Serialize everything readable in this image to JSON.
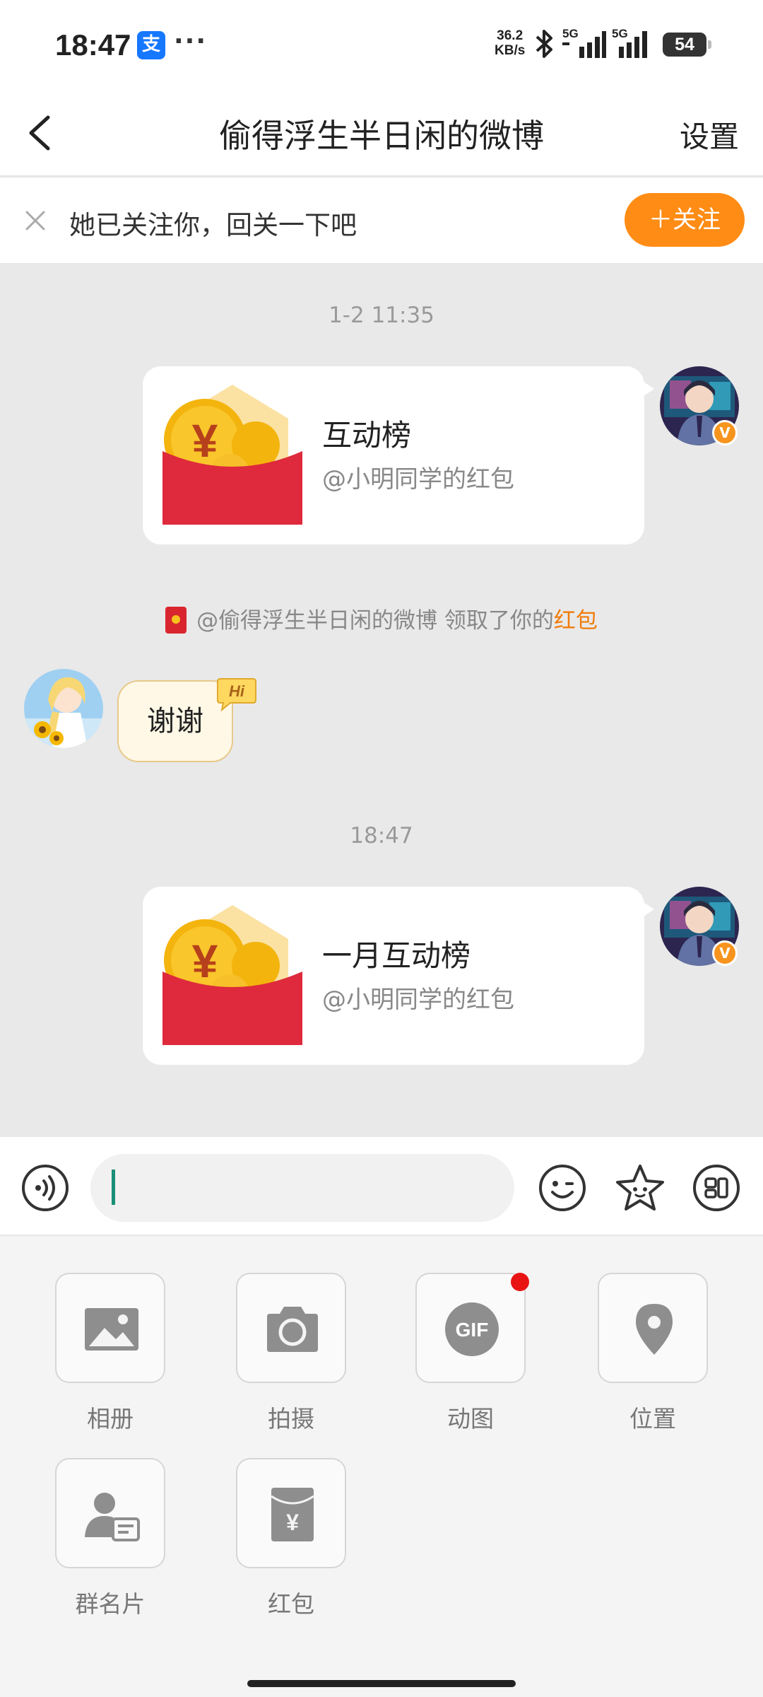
{
  "status_bar": {
    "time": "18:47",
    "alipay_icon_text": "支",
    "more": "···",
    "net_speed_value": "36.2",
    "net_speed_unit": "KB/s",
    "sim1": "5G",
    "sim2": "5G",
    "battery": "54"
  },
  "header": {
    "title": "偷得浮生半日闲的微博",
    "settings_label": "设置"
  },
  "follow_bar": {
    "text": "她已关注你，回关一下吧",
    "button_label": "＋关注",
    "button_color": "#ff8c15"
  },
  "chat": {
    "messages": [
      {
        "timestamp": "1-2 11:35",
        "card_title": "互动榜",
        "card_subtitle": "@小明同学的红包"
      },
      {
        "notice_prefix": "@偷得浮生半日闲的微博 领取了你的",
        "notice_highlight": "红包"
      },
      {
        "text": "谢谢",
        "badge": "Hi"
      },
      {
        "timestamp": "18:47",
        "card_title": "一月互动榜",
        "card_subtitle": "@小明同学的红包"
      }
    ],
    "verified_mark": "V"
  },
  "input_bar": {
    "value": ""
  },
  "panel": {
    "items": [
      {
        "label": "相册",
        "icon": "photo-album-icon"
      },
      {
        "label": "拍摄",
        "icon": "camera-icon"
      },
      {
        "label": "动图",
        "icon": "gif-icon",
        "icon_text": "GIF",
        "has_dot": true
      },
      {
        "label": "位置",
        "icon": "location-pin-icon"
      },
      {
        "label": "群名片",
        "icon": "group-card-icon"
      },
      {
        "label": "红包",
        "icon": "red-packet-icon",
        "icon_text": "¥"
      }
    ]
  },
  "colors": {
    "accent": "#ff8c15",
    "highlight": "#f07c0c",
    "red_packet": "#d9262e",
    "chat_bg": "#e9e9e9"
  }
}
